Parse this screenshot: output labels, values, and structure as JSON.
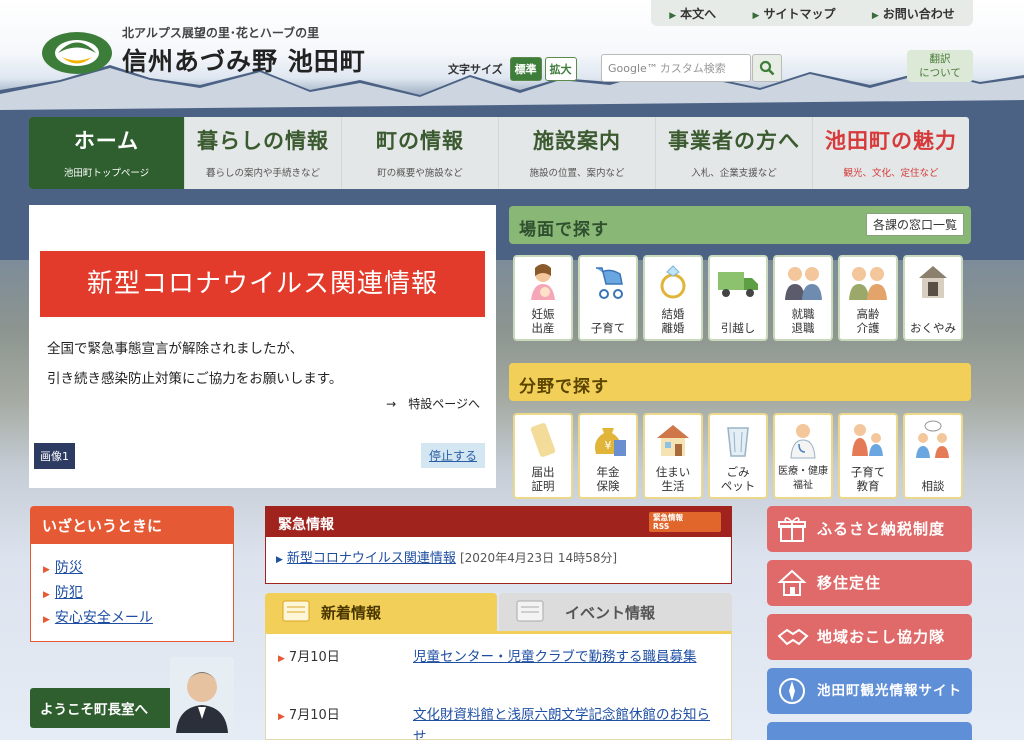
{
  "top_links": [
    "本文へ",
    "サイトマップ",
    "お問い合わせ"
  ],
  "logo": {
    "tagline": "北アルプス展望の里･花とハーブの里",
    "title": "信州あづみ野 池田町"
  },
  "font_size": {
    "label": "文字サイズ",
    "standard": "標準",
    "large": "拡大"
  },
  "search": {
    "brand": "Google™",
    "placeholder": "カスタム検索"
  },
  "translate": [
    "翻訳",
    "について"
  ],
  "nav": [
    {
      "title": "ホーム",
      "sub": "池田町トップページ"
    },
    {
      "title": "暮らしの情報",
      "sub": "暮らしの案内や手続きなど"
    },
    {
      "title": "町の情報",
      "sub": "町の概要や施設など"
    },
    {
      "title": "施設案内",
      "sub": "施設の位置、案内など"
    },
    {
      "title": "事業者の方へ",
      "sub": "入札、企業支援など"
    },
    {
      "title": "池田町の魅力",
      "sub": "観光、文化、定住など"
    }
  ],
  "slide": {
    "banner": "新型コロナウイルス関連情報",
    "line1": "全国で緊急事態宣言が解除されましたが、",
    "line2": "引き続き感染防止対策にご協力をお願いします。",
    "more": "→　特設ページへ",
    "tag": "画像1",
    "stop": "停止する"
  },
  "scene": {
    "title": "場面で探す",
    "link": "各課の窓口一覧",
    "tiles": [
      [
        "妊娠",
        "出産"
      ],
      [
        "子育て"
      ],
      [
        "結婚",
        "離婚"
      ],
      [
        "引越し"
      ],
      [
        "就職",
        "退職"
      ],
      [
        "高齢",
        "介護"
      ],
      [
        "おくやみ"
      ]
    ]
  },
  "field": {
    "title": "分野で探す",
    "tiles": [
      [
        "届出",
        "証明"
      ],
      [
        "年金",
        "保険"
      ],
      [
        "住まい",
        "生活"
      ],
      [
        "ごみ",
        "ペット"
      ],
      [
        "医療・健康",
        "福祉"
      ],
      [
        "子育て",
        "教育"
      ],
      [
        "相談"
      ]
    ]
  },
  "emergency_links": {
    "title": "いざというときに",
    "items": [
      "防災",
      "防犯",
      "安心安全メール"
    ]
  },
  "mayor": {
    "title": "ようこそ町長室へ"
  },
  "alert": {
    "title": "緊急情報",
    "rss": [
      "緊急情報",
      "RSS"
    ],
    "link": "新型コロナウイルス関連情報",
    "date": "[2020年4月23日 14時58分]"
  },
  "tabs": {
    "news": "新着情報",
    "event": "イベント情報"
  },
  "news": [
    {
      "date": "7月10日",
      "title": "児童センター・児童クラブで勤務する職員募集"
    },
    {
      "date": "7月10日",
      "title": "文化財資料館と浅原六朗文学記念館休館のお知らせ"
    }
  ],
  "banners": [
    {
      "label": "ふるさと納税制度",
      "color": "#e06a6a"
    },
    {
      "label": "移住定住",
      "color": "#e06a6a"
    },
    {
      "label": "地域おこし協力隊",
      "color": "#e06a6a"
    },
    {
      "label": "池田町観光情報サイト",
      "color": "#5f8fd6"
    }
  ]
}
